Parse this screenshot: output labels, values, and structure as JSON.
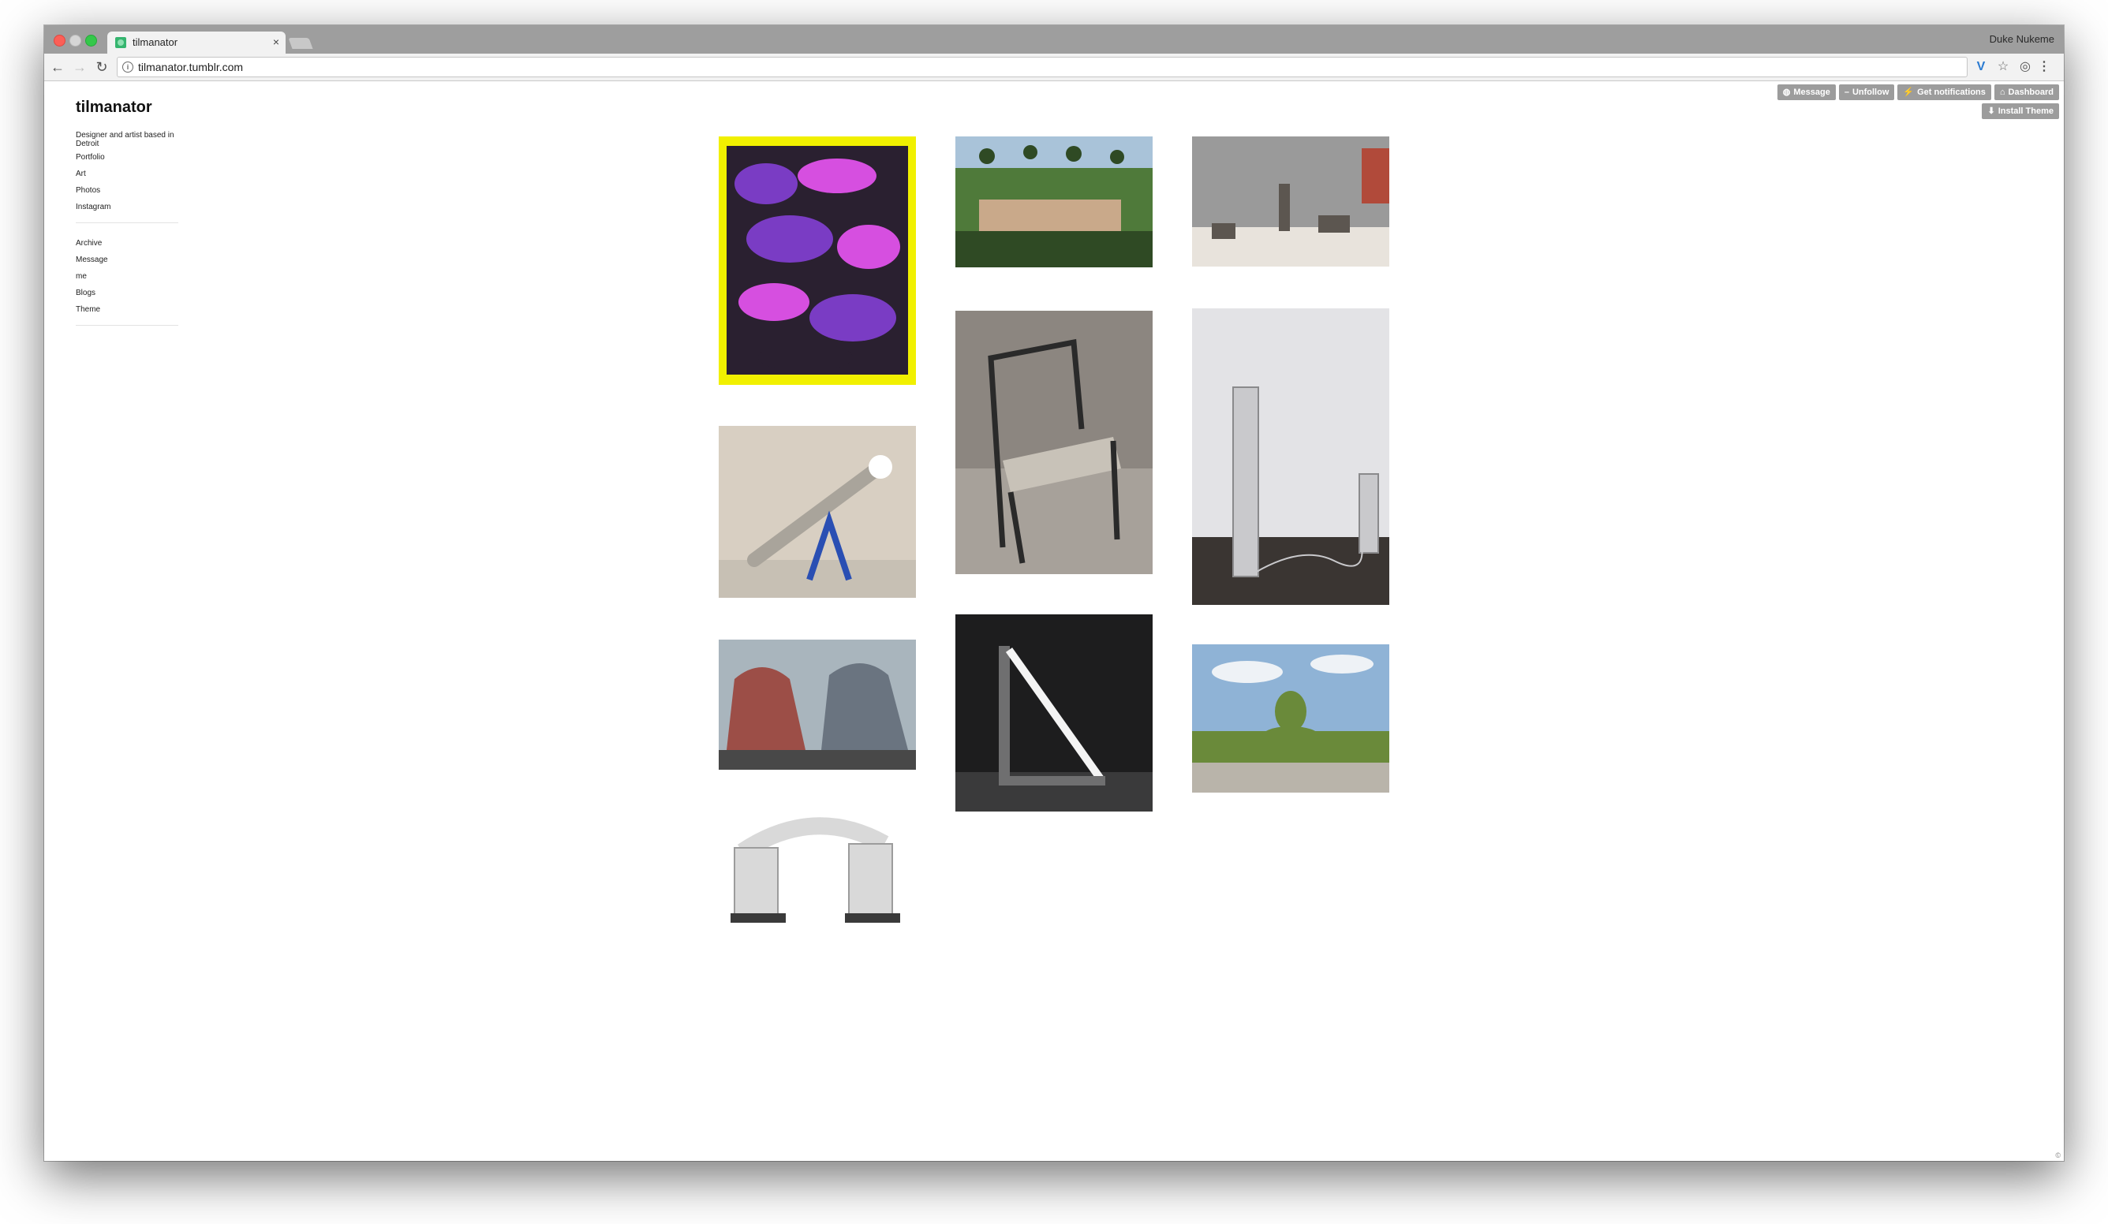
{
  "browser": {
    "tab_title": "tilmanator",
    "tab_close": "×",
    "profile_name": "Duke Nukeme",
    "url": "tilmanator.tumblr.com",
    "nav_back": "←",
    "nav_forward": "→",
    "nav_reload": "↻",
    "ext_v": "V",
    "ext_star": "☆",
    "ext_ghost": "◎",
    "ext_menu": "⋮",
    "info": "i"
  },
  "tumblr_controls": {
    "message": "Message",
    "unfollow": "Unfollow",
    "get_notifications": "Get notifications",
    "dashboard": "Dashboard",
    "install_theme": "Install Theme",
    "icons": {
      "message": "◍",
      "unfollow": "–",
      "notifications": "⚡",
      "dashboard": "⌂",
      "install": "⬇"
    }
  },
  "sidebar": {
    "title": "tilmanator",
    "description": "Designer and artist based in Detroit",
    "links_primary": [
      "Portfolio",
      "Art",
      "Photos",
      "Instagram"
    ],
    "links_secondary": [
      "Archive",
      "Message",
      "me",
      "Blogs",
      "Theme"
    ]
  },
  "posts": [
    {
      "name": "post-abstract-purple-yellow",
      "colors": [
        "#f1f000",
        "#7a3cc4",
        "#2a2030",
        "#d64fe0"
      ]
    },
    {
      "name": "post-garden-palms",
      "colors": [
        "#a9c3d9",
        "#4f7a3a",
        "#2f4a24",
        "#c9a98a"
      ]
    },
    {
      "name": "post-patterned-room",
      "colors": [
        "#9a9a9a",
        "#e8e3dc",
        "#5c5650",
        "#b14a3a"
      ]
    },
    {
      "name": "post-metal-chair",
      "colors": [
        "#8c8680",
        "#a7a19a",
        "#2a2a2a",
        "#c8c2b8"
      ]
    },
    {
      "name": "post-tall-aluminum-pillars",
      "colors": [
        "#c9c9cc",
        "#8a8a8c",
        "#3a3532",
        "#e3e3e6"
      ]
    },
    {
      "name": "post-tube-lamp",
      "colors": [
        "#d8cfc2",
        "#a9a49b",
        "#2a4fb3",
        "#ffffff"
      ]
    },
    {
      "name": "post-brick-sculptures",
      "colors": [
        "#a9b5bd",
        "#9c4e47",
        "#6a7480",
        "#484848"
      ]
    },
    {
      "name": "post-neon-light-sculpture",
      "colors": [
        "#1d1d1e",
        "#f4f4f4",
        "#6f6f70",
        "#3a3a3b"
      ]
    },
    {
      "name": "post-topiary-roundabout",
      "colors": [
        "#8fb3d6",
        "#eef2f6",
        "#6a8a3a",
        "#b9b4aa"
      ]
    },
    {
      "name": "post-brick-arch-drawing",
      "colors": [
        "#ffffff",
        "#9c9c9c",
        "#3a3a3a",
        "#d9d9d9"
      ]
    }
  ],
  "footer": "©"
}
